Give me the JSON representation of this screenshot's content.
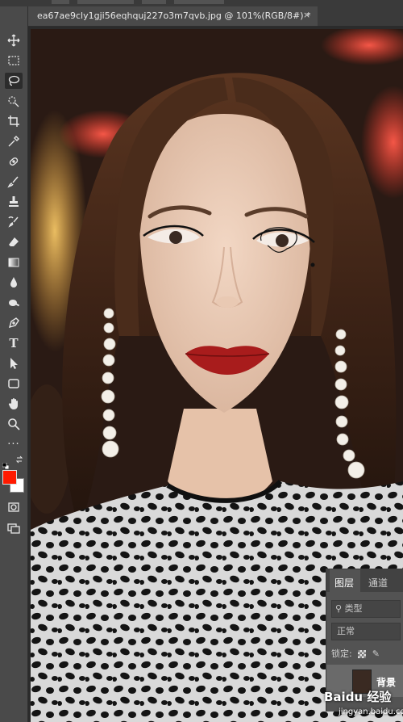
{
  "document": {
    "tab_title": "ea67ae9cly1gji56eqhquj227o3m7qvb.jpg @ 101%(RGB/8#) *",
    "close_glyph": "×"
  },
  "toolbar": {
    "tools": [
      {
        "name": "move-tool-icon"
      },
      {
        "name": "marquee-tool-icon"
      },
      {
        "name": "lasso-tool-icon",
        "active": true
      },
      {
        "name": "quick-select-tool-icon"
      },
      {
        "name": "crop-tool-icon"
      },
      {
        "name": "eyedropper-tool-icon"
      },
      {
        "name": "healing-brush-tool-icon"
      },
      {
        "name": "brush-tool-icon"
      },
      {
        "name": "clone-stamp-tool-icon"
      },
      {
        "name": "history-brush-tool-icon"
      },
      {
        "name": "eraser-tool-icon"
      },
      {
        "name": "gradient-tool-icon"
      },
      {
        "name": "blur-tool-icon"
      },
      {
        "name": "dodge-tool-icon"
      },
      {
        "name": "pen-tool-icon"
      },
      {
        "name": "type-tool-icon"
      },
      {
        "name": "path-select-tool-icon"
      },
      {
        "name": "rectangle-tool-icon"
      },
      {
        "name": "hand-tool-icon"
      },
      {
        "name": "zoom-tool-icon"
      },
      {
        "name": "more-tools-icon"
      }
    ],
    "type_glyph": "T",
    "more_glyph": "···",
    "foreground_color": "#ff1a00",
    "background_color": "#ffffff"
  },
  "layers_panel": {
    "tab_layers": "图层",
    "tab_channels": "通道",
    "filter_label": "类型",
    "blend_mode": "正常",
    "lock_label": "锁定:",
    "layer_name": "背景"
  },
  "watermark": {
    "text": "Baidu 经验",
    "sub": "jingyan.baidu.com"
  }
}
